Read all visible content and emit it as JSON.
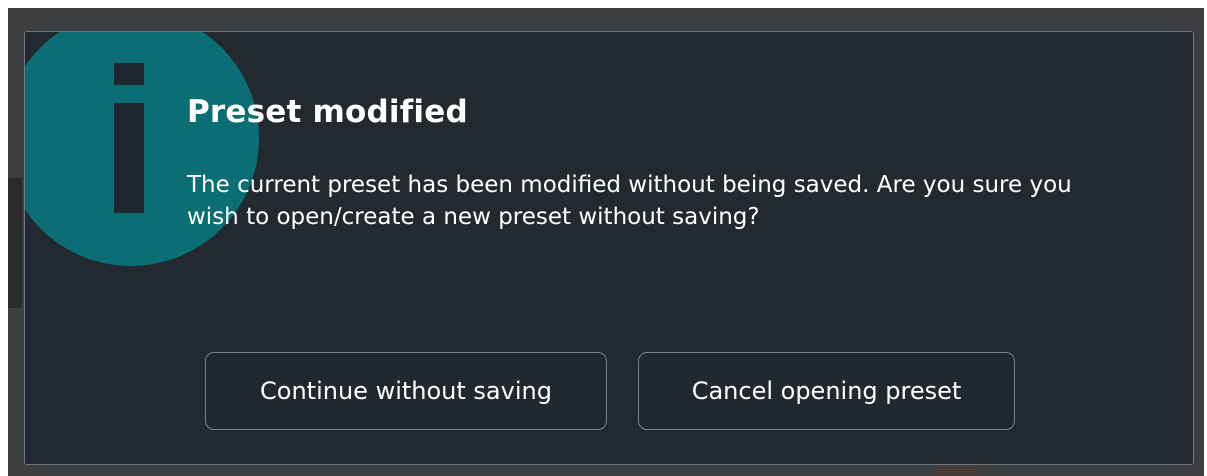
{
  "dialog": {
    "title": "Preset modified",
    "message": "The current preset has been modified without being saved. Are you sure you wish to open/create a new preset without saving?",
    "icon": "info-icon",
    "buttons": {
      "continue_label": "Continue without saving",
      "cancel_label": "Cancel opening preset"
    }
  },
  "colors": {
    "backdrop": "#3d3e40",
    "dialog_background": "#222a30",
    "icon_circle": "#0b6e74",
    "icon_glyph": "#1e282e",
    "button_border": "#7a848c",
    "text": "#ffffff"
  }
}
